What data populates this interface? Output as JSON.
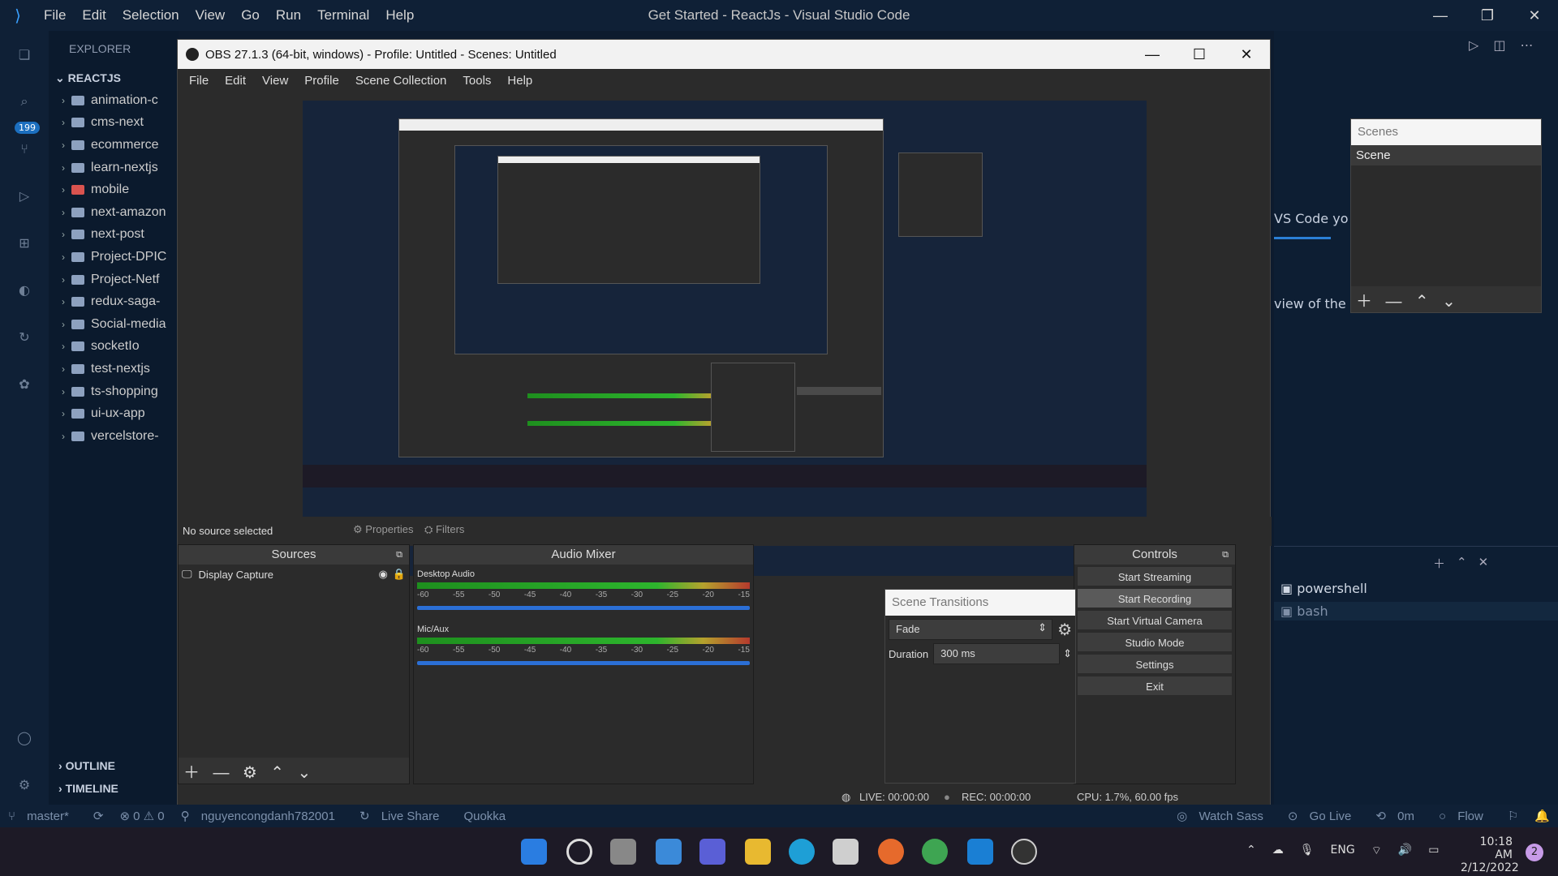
{
  "vscode": {
    "menu": [
      "File",
      "Edit",
      "Selection",
      "View",
      "Go",
      "Run",
      "Terminal",
      "Help"
    ],
    "window_title": "Get Started - ReactJs - Visual Studio Code",
    "badge": "199",
    "explorer_label": "EXPLORER",
    "root": "REACTJS",
    "folders": [
      "animation-c",
      "cms-next",
      "ecommerce",
      "learn-nextjs",
      "mobile",
      "next-amazon",
      "next-post",
      "Project-DPIC",
      "Project-Netf",
      "redux-saga-",
      "Social-media",
      "socketIo",
      "test-nextjs",
      "ts-shopping",
      "ui-ux-app",
      "vercelstore-"
    ],
    "outline": "OUTLINE",
    "timeline": "TIMELINE",
    "editor_fragments": [
      "VS Code yo",
      "view of the m"
    ],
    "terminals": [
      "powershell",
      "bash"
    ],
    "status": {
      "branch": "master*",
      "sync": "",
      "problems": "⊗ 0 ⚠ 0",
      "user": "nguyencongdanh782001",
      "live_share": "Live Share",
      "quokka": "Quokka",
      "watch_sass": "Watch Sass",
      "go_live": "Go Live",
      "time": "0m",
      "flow": "Flow"
    }
  },
  "scenes_panel": {
    "title": "Scenes",
    "item": "Scene"
  },
  "obs": {
    "title": "OBS 27.1.3 (64-bit, windows) - Profile: Untitled - Scenes: Untitled",
    "menu": [
      "File",
      "Edit",
      "View",
      "Profile",
      "Scene Collection",
      "Tools",
      "Help"
    ],
    "no_source": "No source selected",
    "properties": "Properties",
    "filters": "Filters",
    "sources_title": "Sources",
    "source_item": "Display Capture",
    "mixer_title": "Audio Mixer",
    "channels": [
      {
        "name": "Desktop Audio"
      },
      {
        "name": "Mic/Aux"
      }
    ],
    "ticks": [
      "-60",
      "-55",
      "-50",
      "-45",
      "-40",
      "-35",
      "-30",
      "-25",
      "-20",
      "-15"
    ],
    "transitions": {
      "title": "Scene Transitions",
      "fade": "Fade",
      "duration_label": "Duration",
      "duration_value": "300 ms"
    },
    "controls_title": "Controls",
    "controls": [
      "Start Streaming",
      "Start Recording",
      "Start Virtual Camera",
      "Studio Mode",
      "Settings",
      "Exit"
    ],
    "live": "LIVE: 00:00:00",
    "rec": "REC: 00:00:00",
    "cpu": "CPU: 1.7%, 60.00 fps"
  },
  "taskbar": {
    "lang": "ENG",
    "time": "10:18 AM",
    "date": "2/12/2022",
    "notif": "2"
  }
}
